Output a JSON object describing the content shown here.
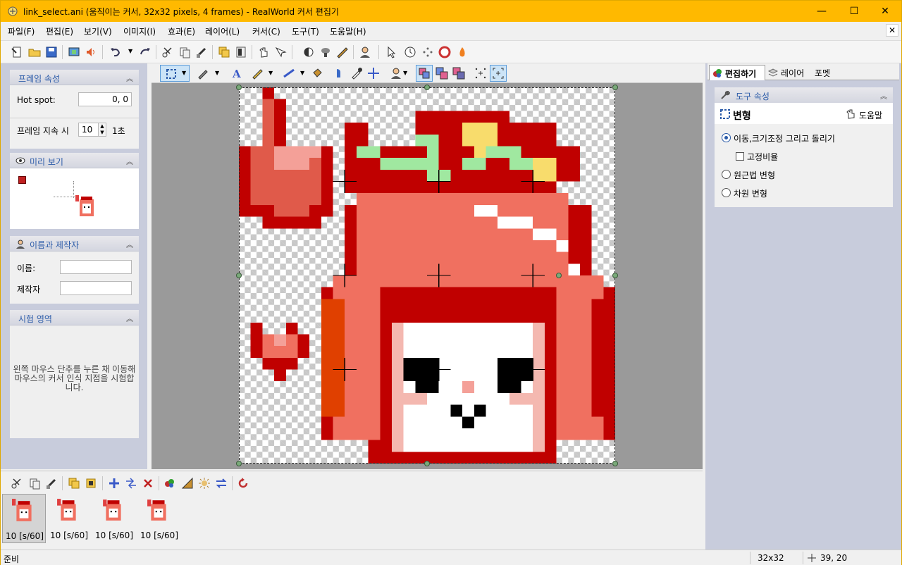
{
  "window": {
    "title": "link_select.ani (움직이는 커서, 32x32 pixels, 4 frames) - RealWorld 커서 편집기",
    "minimize": "—",
    "maximize": "☐",
    "close": "✕"
  },
  "menu": [
    "파일(F)",
    "편집(E)",
    "보기(V)",
    "이미지(I)",
    "효과(E)",
    "레이어(L)",
    "커서(C)",
    "도구(T)",
    "도움말(H)"
  ],
  "mdi_close": "✕",
  "left": {
    "frame_props": {
      "title": "프레임 속성",
      "hotspot_label": "Hot spot:",
      "hotspot_value": "0, 0",
      "duration_label": "프레임 지속 시",
      "duration_value": "10",
      "duration_unit": "1초"
    },
    "preview": {
      "title": "미리 보기"
    },
    "name_author": {
      "title": "이름과 제작자",
      "name_label": "이름:",
      "author_label": "제작자",
      "name_value": "",
      "author_value": ""
    },
    "test_area": {
      "title": "시험 영역",
      "text": "왼쪽 마우스 단추를 누른 채 이동해 마우스의 커서 인식 지점을 시험합니다."
    }
  },
  "right": {
    "tabs": [
      "편집하기",
      "레이어",
      "포멧"
    ],
    "tool_props_title": "도구 속성",
    "transform_title": "변형",
    "help_label": "도움말",
    "options": [
      {
        "label": "이동,크기조정 그리고 돌리기",
        "type": "radio",
        "checked": true
      },
      {
        "label": "고정비율",
        "type": "checkbox",
        "checked": false
      },
      {
        "label": "원근법 변형",
        "type": "radio",
        "checked": false
      },
      {
        "label": "차원 변형",
        "type": "radio",
        "checked": false
      }
    ]
  },
  "frames": [
    {
      "label": "10 [s/60]",
      "selected": true
    },
    {
      "label": "10 [s/60]",
      "selected": false
    },
    {
      "label": "10 [s/60]",
      "selected": false
    },
    {
      "label": "10 [s/60]",
      "selected": false
    }
  ],
  "status": {
    "left": "준비",
    "size": "32x32",
    "coords": "39, 20"
  },
  "colors": {
    "titlebar": "#ffb900",
    "accent_blue": "#2a5aa8",
    "hair_red": "#c00000",
    "hair_salmon": "#f07060",
    "bow_green": "#a0e8a0",
    "bow_yellow": "#f8dc6c"
  }
}
